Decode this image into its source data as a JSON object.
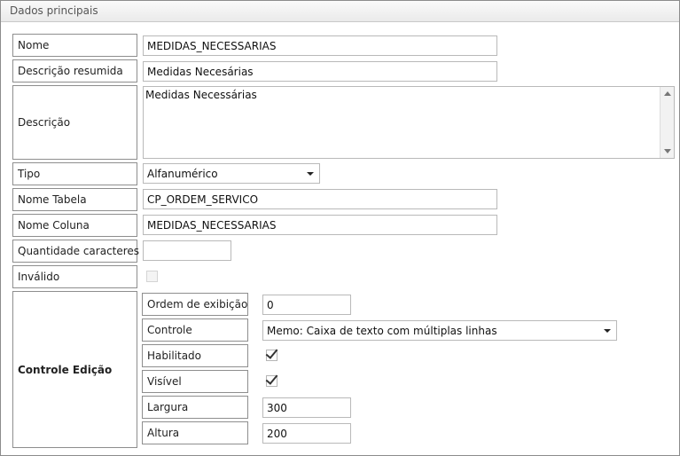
{
  "section": {
    "title": "Dados principais"
  },
  "fields": {
    "nome": {
      "label": "Nome",
      "value": "MEDIDAS_NECESSARIAS"
    },
    "descricao_resumida": {
      "label": "Descrição resumida",
      "value": "Medidas Necesárias"
    },
    "descricao": {
      "label": "Descrição",
      "value": "Medidas Necessárias"
    },
    "tipo": {
      "label": "Tipo",
      "value": "Alfanumérico"
    },
    "nome_tabela": {
      "label": "Nome Tabela",
      "value": "CP_ORDEM_SERVICO"
    },
    "nome_coluna": {
      "label": "Nome Coluna",
      "value": "MEDIDAS_NECESSARIAS"
    },
    "quantidade_caracteres": {
      "label": "Quantidade caracteres",
      "value": ""
    },
    "invalido": {
      "label": "Inválido",
      "checked": false
    }
  },
  "controle_edicao": {
    "label": "Controle Edição",
    "ordem_exibicao": {
      "label": "Ordem de exibição",
      "value": "0"
    },
    "controle": {
      "label": "Controle",
      "value": "Memo: Caixa de texto com múltiplas linhas"
    },
    "habilitado": {
      "label": "Habilitado",
      "checked": true
    },
    "visivel": {
      "label": "Visível",
      "checked": true
    },
    "largura": {
      "label": "Largura",
      "value": "300"
    },
    "altura": {
      "label": "Altura",
      "value": "200"
    }
  }
}
